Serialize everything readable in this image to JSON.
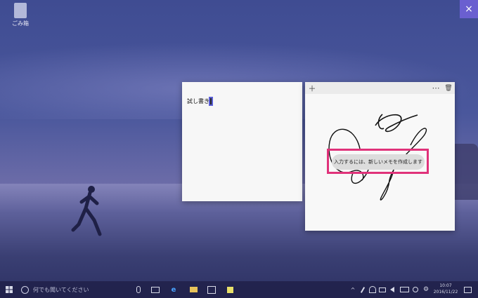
{
  "desktop": {
    "icon_label": "ごみ箱"
  },
  "note_left": {
    "text": "試し書き"
  },
  "note_right": {
    "add_icon": "＋",
    "more_icon": "⋯",
    "trash_icon": "🗑",
    "toast_text": "入力するには、新しいメモを作成します"
  },
  "top_right": {
    "close_icon": "×"
  },
  "taskbar": {
    "search_placeholder": "何でも聞いてください",
    "time": "10:07",
    "date": "2016/11/22"
  },
  "colors": {
    "highlight": "#e0327a",
    "accent": "#6a5fd0"
  }
}
